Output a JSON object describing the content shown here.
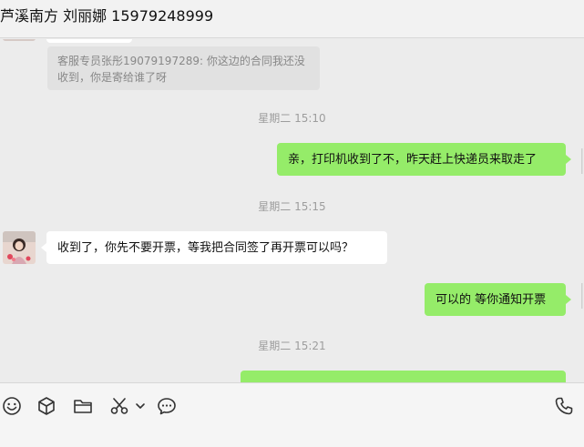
{
  "header": {
    "title": "芦溪南方 刘丽娜 15979248999"
  },
  "messages": {
    "quote_text": "客服专员张彤19079197289: 你这边的合同我还没收到，你是寄给谁了呀",
    "ts1": "星期二 15:10",
    "msg_out_1": "亲，打印机收到了不，昨天赶上快递员来取走了",
    "ts2": "星期二 15:15",
    "msg_in_1": "收到了，你先不要开票，等我把合同签了再开票可以吗？",
    "msg_out_2": "可以的 等你通知开票",
    "ts3": "星期二 15:21"
  },
  "colors": {
    "outgoing_bubble": "#95ec69",
    "incoming_bubble": "#ffffff",
    "background": "#ececec"
  },
  "toolbar": {
    "icons": [
      "emoji-icon",
      "sticker-box-icon",
      "folder-icon",
      "scissors-icon",
      "chevron-down-icon",
      "chat-history-icon",
      "phone-icon"
    ]
  }
}
